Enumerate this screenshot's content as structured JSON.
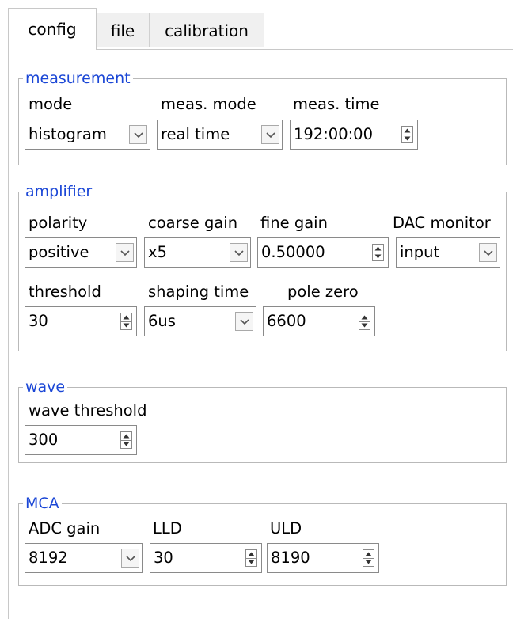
{
  "tabs": [
    {
      "label": "config",
      "active": true
    },
    {
      "label": "file",
      "active": false
    },
    {
      "label": "calibration",
      "active": false
    }
  ],
  "measurement": {
    "title": "measurement",
    "mode": {
      "label": "mode",
      "value": "histogram"
    },
    "meas_mode": {
      "label": "meas. mode",
      "value": "real time"
    },
    "meas_time": {
      "label": "meas. time",
      "value": "192:00:00"
    }
  },
  "amplifier": {
    "title": "amplifier",
    "polarity": {
      "label": "polarity",
      "value": "positive"
    },
    "coarse_gain": {
      "label": "coarse gain",
      "value": "x5"
    },
    "fine_gain": {
      "label": "fine gain",
      "value": "0.50000"
    },
    "dac_monitor": {
      "label": "DAC monitor",
      "value": "input"
    },
    "threshold": {
      "label": "threshold",
      "value": "30"
    },
    "shaping_time": {
      "label": "shaping time",
      "value": "6us"
    },
    "pole_zero": {
      "label": "pole zero",
      "value": "6600"
    }
  },
  "wave": {
    "title": "wave",
    "wave_threshold": {
      "label": "wave threshold",
      "value": "300"
    }
  },
  "mca": {
    "title": "MCA",
    "adc_gain": {
      "label": "ADC gain",
      "value": "8192"
    },
    "lld": {
      "label": "LLD",
      "value": "30"
    },
    "uld": {
      "label": "ULD",
      "value": "8190"
    }
  },
  "colors": {
    "group_title": "#1a46d6",
    "border": "#b9b9b9"
  }
}
